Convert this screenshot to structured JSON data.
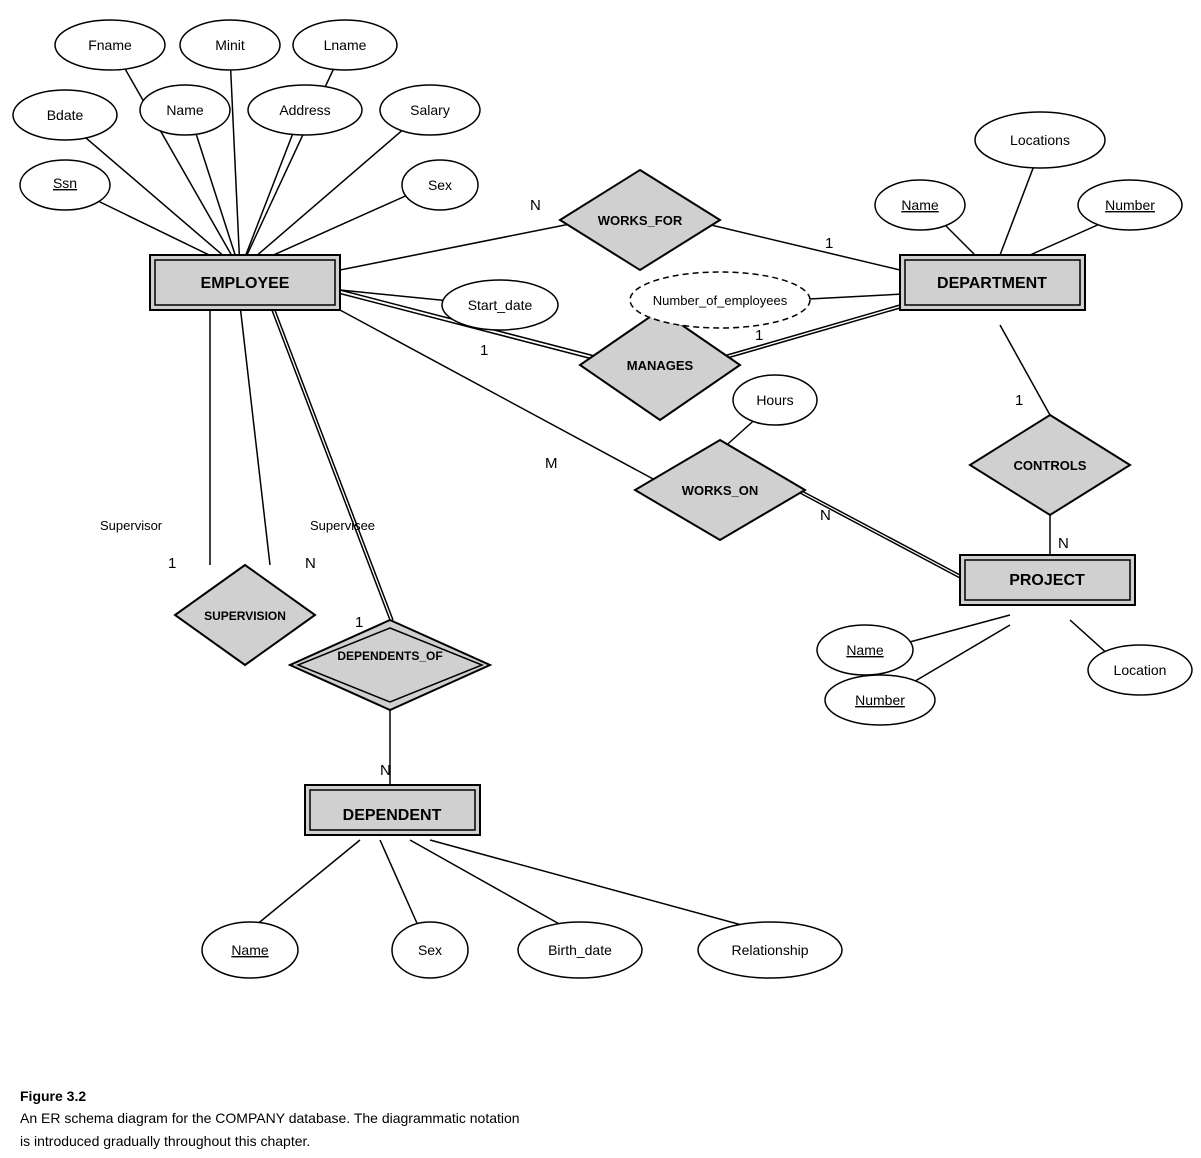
{
  "caption": {
    "title": "Figure 3.2",
    "line1": "An ER schema diagram for the COMPANY database. The diagrammatic notation",
    "line2": "is introduced gradually throughout this chapter."
  },
  "entities": {
    "employee": "EMPLOYEE",
    "department": "DEPARTMENT",
    "project": "PROJECT",
    "dependent": "DEPENDENT"
  },
  "relationships": {
    "works_for": "WORKS_FOR",
    "manages": "MANAGES",
    "controls": "CONTROLS",
    "works_on": "WORKS_ON",
    "supervision": "SUPERVISION",
    "dependents_of": "DEPENDENTS_OF"
  },
  "attributes": {
    "fname": "Fname",
    "minit": "Minit",
    "lname": "Lname",
    "bdate": "Bdate",
    "name_emp": "Name",
    "address": "Address",
    "salary": "Salary",
    "ssn": "Ssn",
    "sex_emp": "Sex",
    "start_date": "Start_date",
    "num_employees": "Number_of_employees",
    "locations": "Locations",
    "dept_name": "Name",
    "dept_number": "Number",
    "hours": "Hours",
    "proj_name": "Name",
    "proj_number": "Number",
    "location": "Location",
    "dep_name": "Name",
    "dep_sex": "Sex",
    "birth_date": "Birth_date",
    "relationship": "Relationship"
  },
  "cardinalities": {
    "n1": "N",
    "one1": "1",
    "one2": "1",
    "one3": "1",
    "m": "M",
    "n2": "N",
    "n3": "N",
    "one4": "1",
    "supervisor": "Supervisor",
    "supervisee": "Supervisee",
    "n4": "N",
    "one5": "1",
    "n5": "N"
  }
}
